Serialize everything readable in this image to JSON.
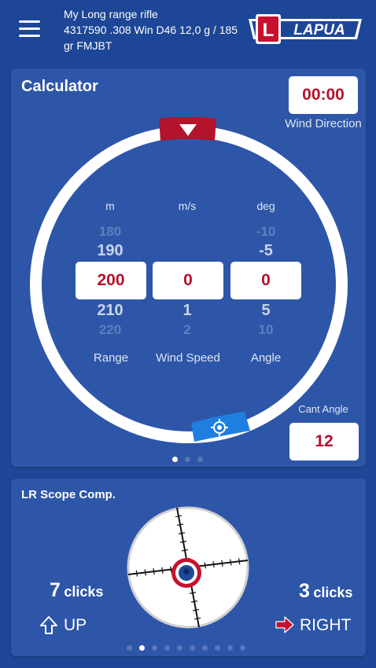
{
  "header": {
    "title": "My Long range rifle",
    "info": "4317590 .308 Win  D46 12,0 g / 185 gr  FMJBT",
    "logo_text": "LAPUA",
    "logo_letter": "L"
  },
  "calculator": {
    "title": "Calculator",
    "wind_direction_value": "00:00",
    "wind_direction_label": "Wind Direction",
    "cant_angle_label": "Cant Angle",
    "cant_angle_value": "12",
    "columns": [
      {
        "unit": "m",
        "far_above": "180",
        "near_above": "190",
        "value": "200",
        "near_below": "210",
        "far_below": "220",
        "label": "Range"
      },
      {
        "unit": "m/s",
        "far_above": "",
        "near_above": "",
        "value": "0",
        "near_below": "1",
        "far_below": "2",
        "label": "Wind Speed"
      },
      {
        "unit": "deg",
        "far_above": "-10",
        "near_above": "-5",
        "value": "0",
        "near_below": "5",
        "far_below": "10",
        "label": "Angle"
      }
    ],
    "page_count": 3,
    "active_page": 0
  },
  "scope": {
    "title": "LR Scope Comp.",
    "elevation_clicks": "7",
    "elevation_word": "clicks",
    "elevation_direction": "UP",
    "windage_clicks": "3",
    "windage_word": "clicks",
    "windage_direction": "RIGHT",
    "page_count": 10,
    "active_page": 1
  },
  "colors": {
    "background": "#1e4797",
    "card": "#2d56a8",
    "accent_red": "#b5122c",
    "target_icon_blue": "#1f7fe0"
  },
  "icons": {
    "menu": "hamburger-icon",
    "wind_marker": "triangle-down-icon",
    "cant_marker": "crosshair-target-icon",
    "up": "arrow-up-outline-icon",
    "right": "arrow-right-icon"
  }
}
